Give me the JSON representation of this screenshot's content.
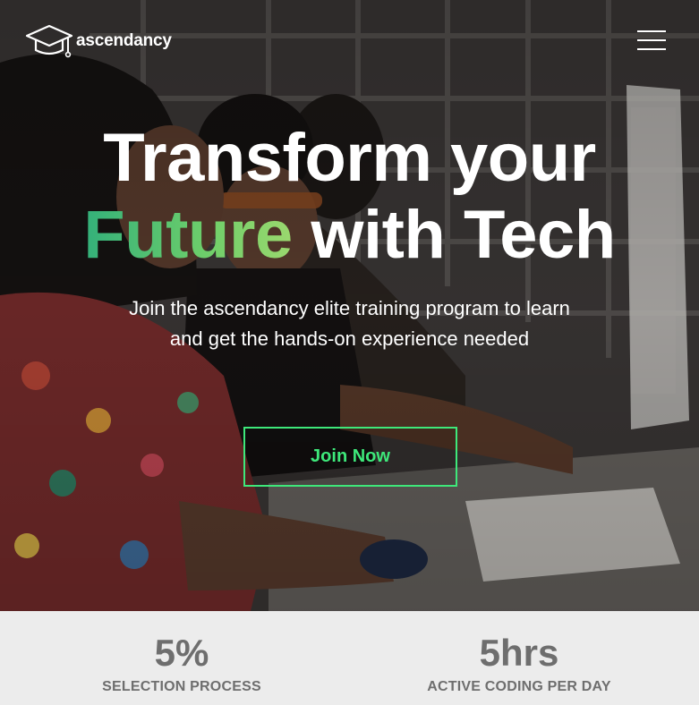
{
  "brand": {
    "name": "ascendancy",
    "logo_icon": "graduation-cap-icon"
  },
  "nav": {
    "menu_icon": "hamburger-menu-icon"
  },
  "hero": {
    "headline_line1": "Transform your",
    "headline_accent": "Future",
    "headline_rest": "with Tech",
    "subtext": "Join the ascendancy elite training program to learn and get the hands-on experience needed",
    "cta_label": "Join Now"
  },
  "stats": [
    {
      "value": "5%",
      "label": "SELECTION PROCESS"
    },
    {
      "value": "5hrs",
      "label": "ACTIVE CODING PER DAY"
    }
  ],
  "colors": {
    "accent_green": "#3ee87a",
    "headline_gradient_start": "#33b07a",
    "headline_gradient_end": "#9bd86e",
    "stat_text": "#6e6e6e",
    "stats_background": "#ececec"
  }
}
